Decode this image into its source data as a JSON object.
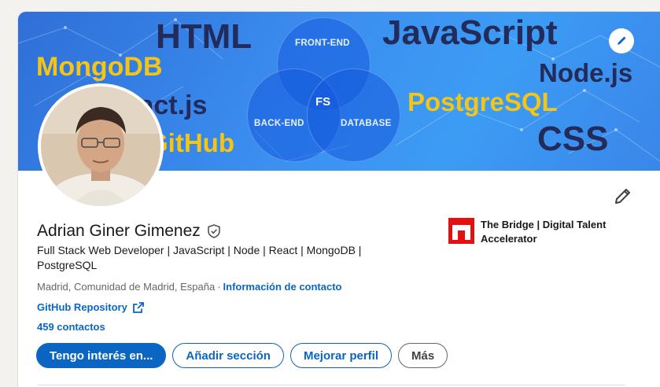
{
  "banner": {
    "tech_labels": [
      "HTML",
      "JavaScript",
      "MongoDB",
      "Node.js",
      "PostgreSQL",
      "CSS",
      "GitHub",
      "React.js"
    ],
    "venn": {
      "front_end": "FRONT-END",
      "back_end": "BACK-END",
      "database": "DATABASE",
      "center": "FS"
    }
  },
  "profile": {
    "name": "Adrian Giner Gimenez",
    "headline": "Full Stack Web Developer | JavaScript | Node | React | MongoDB | PostgreSQL",
    "location": "Madrid, Comunidad de Madrid, España",
    "separator": "·",
    "contact_info_link": "Información de contacto",
    "repo_link": "GitHub Repository",
    "connections": "459 contactos"
  },
  "company": {
    "name": "The Bridge | Digital Talent Accelerator"
  },
  "actions": {
    "primary": "Tengo interés en...",
    "add_section": "Añadir sección",
    "improve_profile": "Mejorar perfil",
    "more": "Más"
  },
  "colors": {
    "link": "#0a66c2",
    "banner": "#3b8ff0",
    "company_logo": "#e3100f"
  },
  "icons": [
    "pencil-icon",
    "verified-shield-icon",
    "external-link-icon"
  ]
}
